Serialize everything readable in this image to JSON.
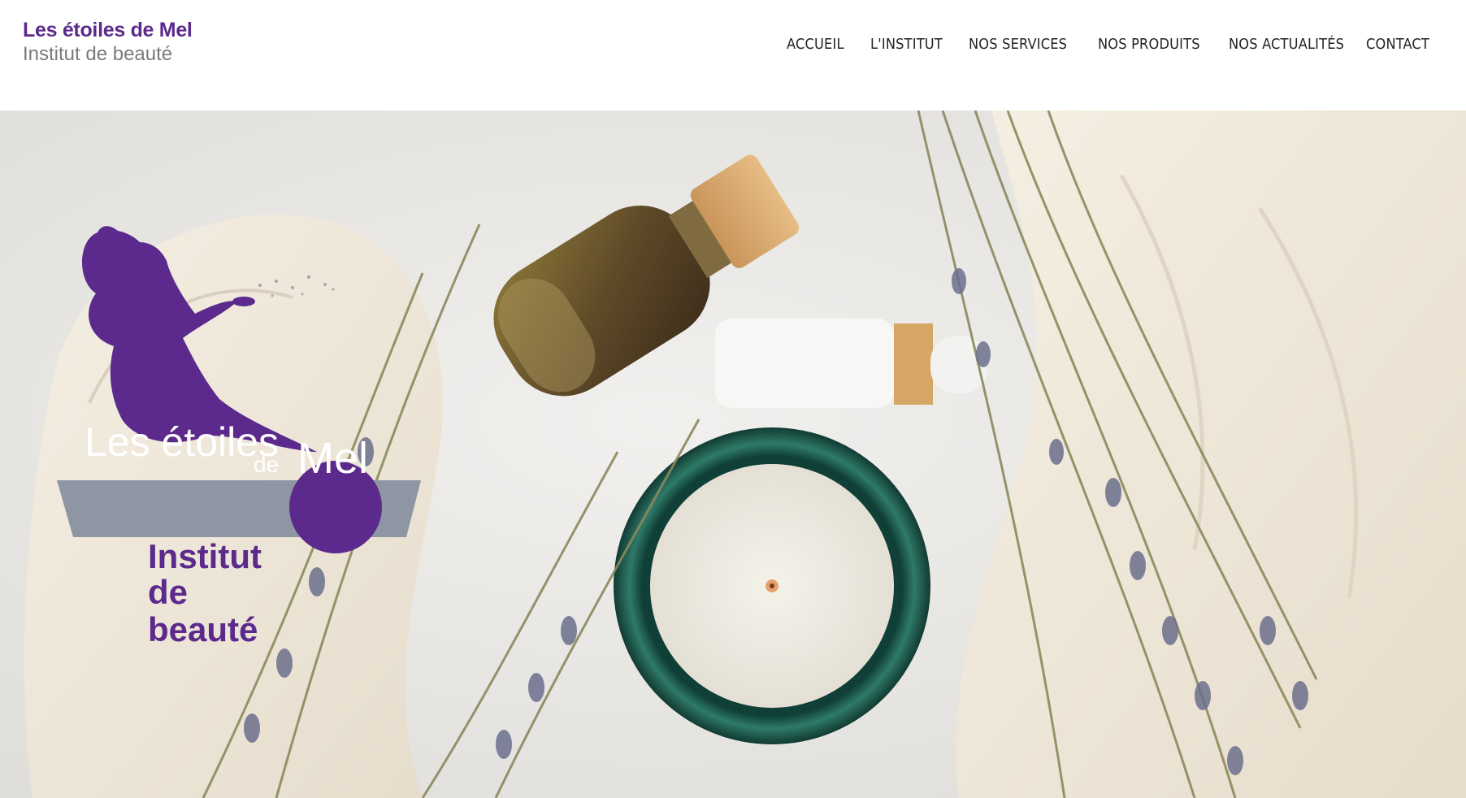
{
  "brand": {
    "name": "Les étoiles de Mel",
    "subtitle": "Institut de beauté"
  },
  "nav": {
    "items": [
      {
        "label": "ACCUEIL"
      },
      {
        "label": "L'INSTITUT"
      },
      {
        "label": "NOS SERVICES"
      },
      {
        "label": "NOS PRODUITS"
      },
      {
        "label": "NOS ACTUALITÉS"
      },
      {
        "label": "CONTACT"
      }
    ]
  },
  "hero": {
    "logo": {
      "line1": "Les étoiles",
      "de": "de",
      "mel": "Mel",
      "line3": "Institut",
      "line4": "de beauté"
    }
  },
  "colors": {
    "brand_purple": "#5b2a8c",
    "logo_gray": "#8f96a3",
    "nav_text": "#222222"
  }
}
